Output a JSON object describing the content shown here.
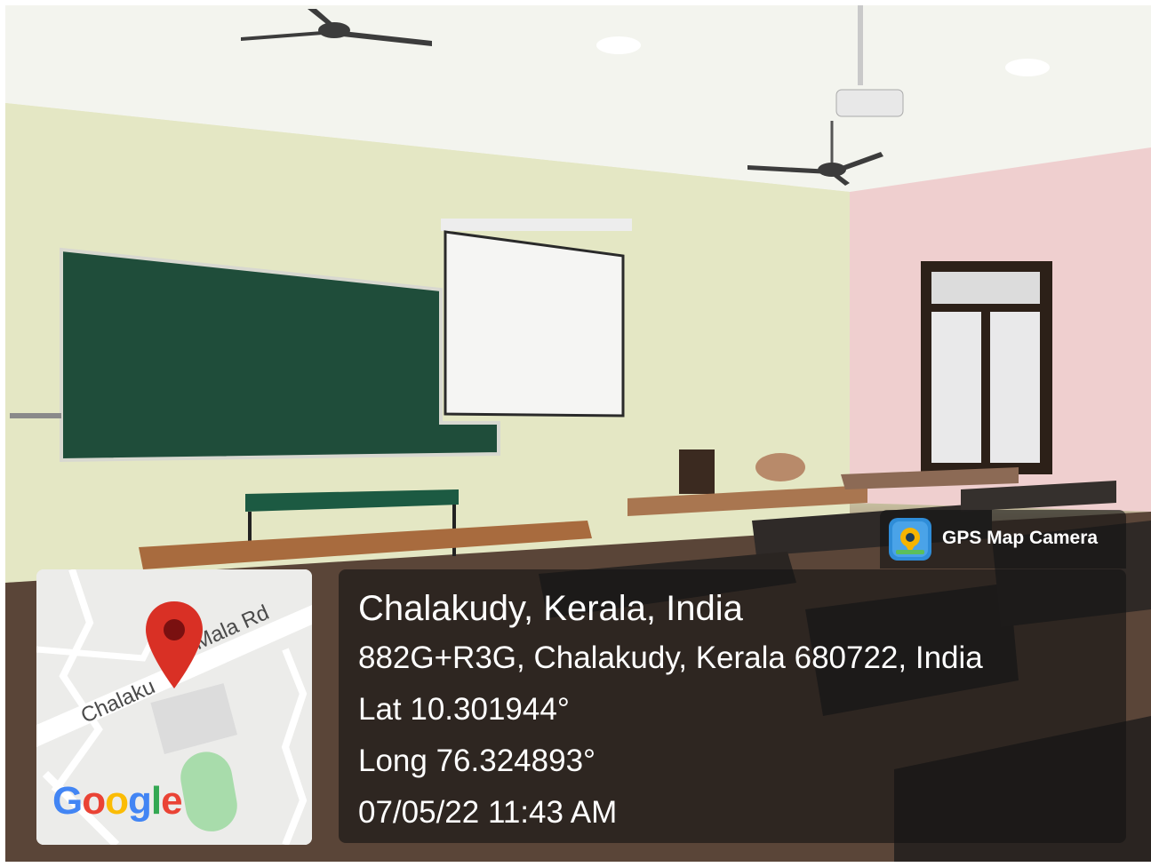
{
  "app_badge": {
    "label": "GPS Map Camera",
    "icon": "gps-camera-icon"
  },
  "location": {
    "title": "Chalakudy, Kerala, India",
    "address": "882G+R3G, Chalakudy, Kerala 680722, India",
    "latitude": "Lat 10.301944°",
    "longitude": "Long 76.324893°",
    "datetime": "07/05/22 11:43 AM"
  },
  "map": {
    "road_label_left": "Chalaku",
    "road_label_right": "Mala Rd",
    "logo_letters": [
      "G",
      "o",
      "o",
      "g",
      "l",
      "e"
    ],
    "pin_icon": "map-pin-icon"
  },
  "colors": {
    "google_blue": "#4285f4",
    "google_red": "#ea4335",
    "google_yellow": "#fbbc05",
    "google_green": "#34a853",
    "pin_red": "#d93025"
  }
}
